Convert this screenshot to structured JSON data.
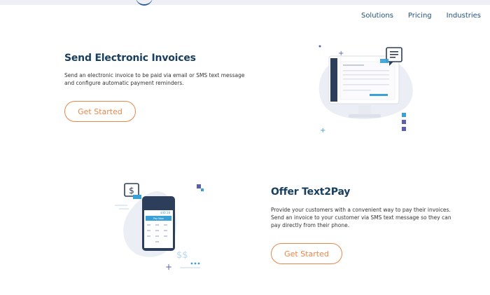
{
  "nav": {
    "items": [
      "Solutions",
      "Pricing",
      "Industries"
    ]
  },
  "section1": {
    "title": "Send Electronic Invoices",
    "description_line1": "Send an electronic invoice to be paid via email or SMS text message",
    "description_line2": "and configure automatic payment reminders.",
    "button": "Get Started"
  },
  "section2": {
    "title": "Offer Text2Pay",
    "description_line1": "Provide your customers with a convenient way to pay their invoices.",
    "description_line2": "Send an invoice to your customer via SMS text message so they can",
    "description_line3": "pay directly from their phone.",
    "button": "Get Started",
    "phone_amount": "$40.18",
    "phone_pay_label": "Pay Now",
    "money_text": "$$"
  },
  "colors": {
    "accent_orange": "#e8874a",
    "heading_navy": "#173e5e",
    "illustration_blue": "#3aa0d8",
    "blob": "#eceef6"
  }
}
